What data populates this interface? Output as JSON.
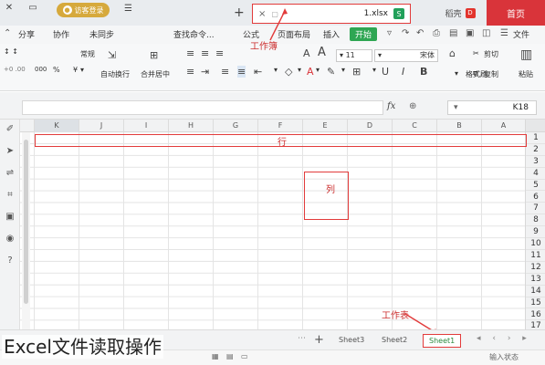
{
  "titlebar": {
    "home_tab": "首页",
    "wps_tab": "稻壳",
    "wps_logo": "D",
    "doc_name": "1.xlsx",
    "doc_icon": "S",
    "doc_close": "×",
    "doc_pin": "▢",
    "new_tab": "+",
    "user_label": "访客登录",
    "menu_icon": "☰"
  },
  "menubar": {
    "items": [
      "文件",
      "开始",
      "插入",
      "页面布局",
      "公式",
      "查找命令..."
    ],
    "right_items": [
      "未同步",
      "协作",
      "分享"
    ],
    "active": "开始"
  },
  "ribbon": {
    "paste": "粘贴",
    "cut": "剪切",
    "copy": "复制",
    "format_painter": "格式刷",
    "font_name": "宋体",
    "font_size": "11",
    "bold": "B",
    "italic": "I",
    "underline": "U",
    "merge_center": "合并居中",
    "wrap_text": "自动换行",
    "number_format": "常规",
    "currency": "¥",
    "percent": "%",
    "thousands": "000",
    "increase_decimal": "+0",
    "decrease_decimal": ".00",
    "font_grow": "A",
    "font_shrink": "A"
  },
  "formula_bar": {
    "name_box_value": "K18",
    "fx": "fx"
  },
  "columns": [
    "A",
    "B",
    "C",
    "D",
    "E",
    "F",
    "G",
    "H",
    "I",
    "J",
    "K"
  ],
  "rows": [
    "1",
    "2",
    "3",
    "4",
    "5",
    "6",
    "7",
    "8",
    "9",
    "10",
    "11",
    "12",
    "13",
    "14",
    "15",
    "16",
    "17"
  ],
  "annotations": {
    "row_label": "行",
    "column_label": "列",
    "workbook_label": "工作簿",
    "worksheet_label": "工作表"
  },
  "sheets": [
    "Sheet1",
    "Sheet2",
    "Sheet3"
  ],
  "active_sheet": "Sheet1",
  "statusbar": {
    "input_mode": "输入状态"
  },
  "caption": "Excel文件读取操作",
  "colors": {
    "accent_red": "#d9343a",
    "active_green": "#2ea653",
    "annotation_red": "#e23b3b"
  }
}
